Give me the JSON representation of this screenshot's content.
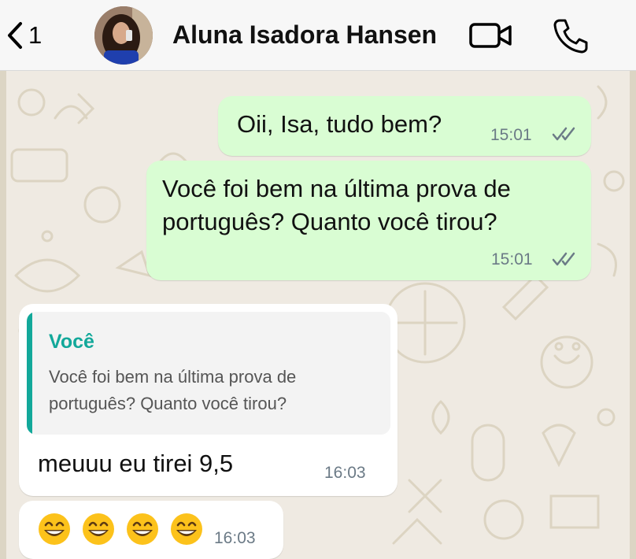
{
  "header": {
    "back_count": "1",
    "contact_name": "Aluna Isadora Hansen",
    "icons": [
      "back-chevron-icon",
      "avatar",
      "video-camera-icon",
      "phone-icon"
    ]
  },
  "messages": [
    {
      "direction": "outgoing",
      "text": "Oii, Isa, tudo bem?",
      "time": "15:01",
      "status": "read"
    },
    {
      "direction": "outgoing",
      "text_lines": [
        "Você foi bem na última prova de",
        "português? Quanto você tirou?"
      ],
      "time": "15:01",
      "status": "read"
    },
    {
      "direction": "incoming",
      "quote": {
        "author": "Você",
        "lines": [
          "Você foi bem na última prova de",
          "português? Quanto você tirou?"
        ]
      },
      "text": "meuuu eu tirei 9,5",
      "time": "16:03"
    },
    {
      "direction": "incoming",
      "emoji_count": 4,
      "emoji": "grinning-face-with-smiling-eyes",
      "time": "16:03"
    }
  ],
  "colors": {
    "outgoing_bubble": "#d9fdd3",
    "incoming_bubble": "#ffffff",
    "chat_background": "#efeae2",
    "quote_accent": "#12a89a",
    "read_ticks": "#6b7a86"
  }
}
